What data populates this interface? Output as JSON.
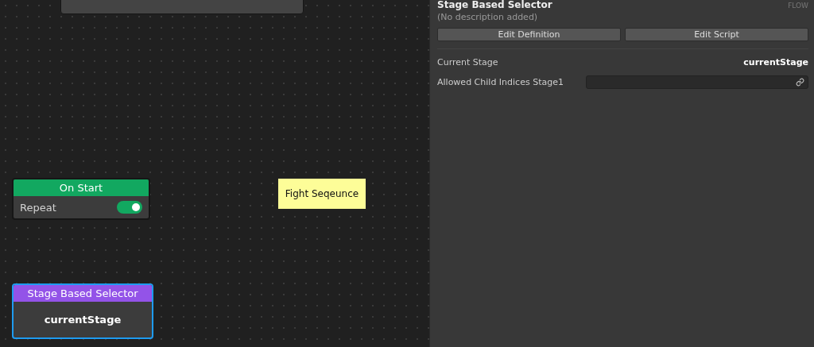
{
  "canvas": {
    "nodes": [
      {
        "kind": "event",
        "title": "On Start",
        "selected": false,
        "color": "#12a860",
        "row": {
          "label": "Repeat",
          "on": true
        }
      },
      {
        "kind": "note",
        "text": "Fight Seqeunce"
      },
      {
        "kind": "selector",
        "title": "Stage Based Selector",
        "selected": true,
        "color": "#9353e8",
        "value": "currentStage"
      }
    ]
  },
  "inspector": {
    "title": "Stage Based Selector",
    "category": "FLOW",
    "description": "(No description added)",
    "buttons": [
      "Edit Definition",
      "Edit Script"
    ],
    "fields": [
      {
        "kind": "value",
        "label": "Current Stage",
        "value": "currentStage"
      },
      {
        "kind": "link",
        "label": "Allowed Child Indices Stage1"
      }
    ]
  }
}
